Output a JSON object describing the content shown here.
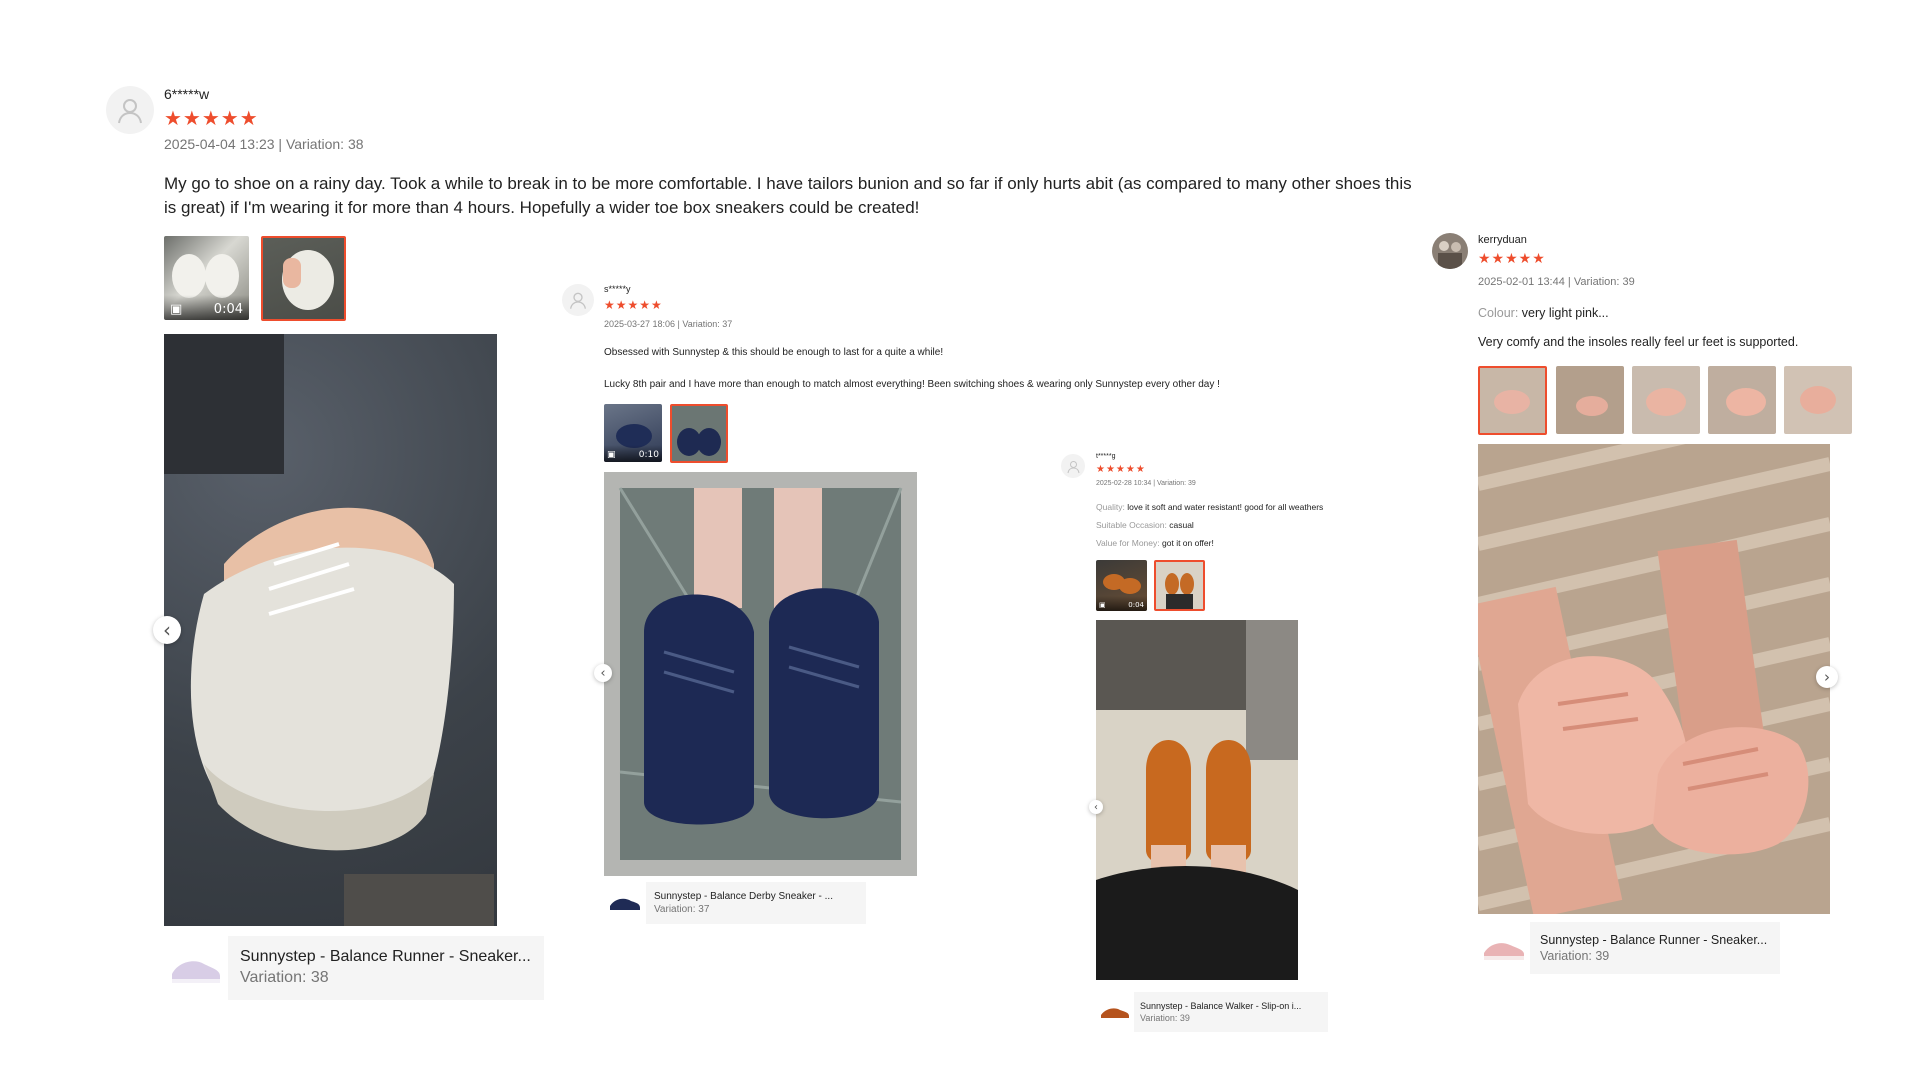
{
  "reviews": [
    {
      "username": "6*****w",
      "stars": "★★★★★",
      "meta": "2025-04-04 13:23 | Variation: 38",
      "text": "My go to shoe on a rainy day. Took a while to break in to be more comfortable. I have tailors bunion and so far if only hurts abit (as compared to many other shoes this is great) if I'm wearing it for more than 4 hours. Hopefully a wider toe box sneakers could be created!",
      "video_duration": "0:04",
      "product_name": "Sunnystep - Balance Runner - Sneaker...",
      "product_variation": "Variation: 38"
    },
    {
      "username": "s*****y",
      "stars": "★★★★★",
      "meta": "2025-03-27 18:06 | Variation: 37",
      "text_1": "Obsessed with Sunnystep & this should be enough to last for a quite a while!",
      "text_2": "Lucky 8th pair and I have more than enough to match almost everything! Been switching shoes & wearing only Sunnystep every other day !",
      "video_duration": "0:10",
      "product_name": "Sunnystep - Balance Derby Sneaker - ...",
      "product_variation": "Variation: 37"
    },
    {
      "username": "t*****g",
      "stars": "★★★★★",
      "meta": "2025-02-28 10:34 | Variation: 39",
      "quality_label": "Quality:",
      "quality_value": "love it soft and water resistant! good for all weathers",
      "occasion_label": "Suitable Occasion:",
      "occasion_value": "casual",
      "value_label": "Value for Money:",
      "value_value": "got it on offer!",
      "video_duration": "0:04",
      "product_name": "Sunnystep - Balance Walker - Slip-on i...",
      "product_variation": "Variation: 39"
    },
    {
      "username": "kerryduan",
      "stars": "★★★★★",
      "meta": "2025-02-01 13:44 | Variation: 39",
      "colour_label": "Colour:",
      "colour_value": "very light pink...",
      "text": "Very comfy and the insoles really feel ur feet is supported.",
      "product_name": "Sunnystep - Balance Runner - Sneaker...",
      "product_variation": "Variation: 39"
    }
  ],
  "icons": {
    "prev": "‹",
    "next": "›",
    "video": "video-camera-icon"
  },
  "colors": {
    "accent": "#ee4d2d",
    "meta_grey": "#757575",
    "card_bg": "#f5f5f5"
  }
}
